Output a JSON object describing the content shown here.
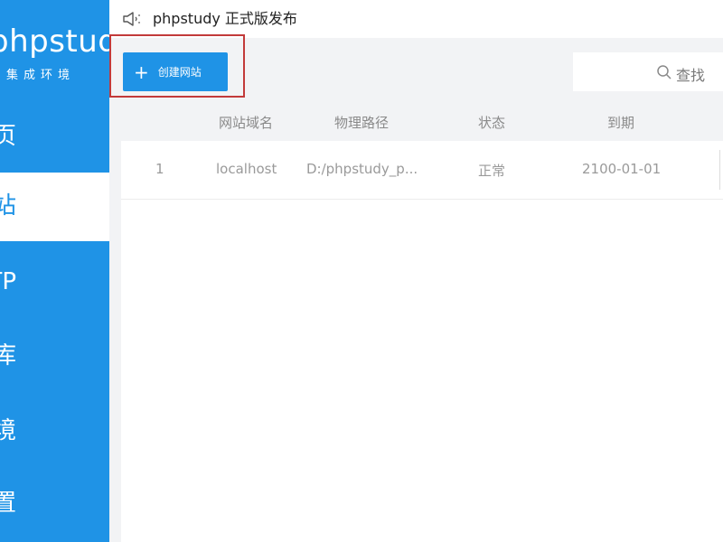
{
  "sidebar": {
    "logo": "phpstudy",
    "logo_sub": "集成环境",
    "items": [
      {
        "label": "首页"
      },
      {
        "label": "网站",
        "active": true
      },
      {
        "label": "FTP"
      },
      {
        "label": "数据库"
      },
      {
        "label": "环境"
      },
      {
        "label": "设置"
      }
    ]
  },
  "topbar": {
    "icon": "speaker-icon",
    "notice": "phpstudy 正式版发布"
  },
  "toolbar": {
    "create_label": "创建网站",
    "create_icon": "plus-icon",
    "search_label": "查找",
    "search_icon": "search-icon"
  },
  "table": {
    "columns": [
      "网站域名",
      "物理路径",
      "状态",
      "到期"
    ],
    "rows": [
      {
        "index": "1",
        "domain": "localhost",
        "path": "D:/phpstudy_p...",
        "status": "正常",
        "expiry": "2100-01-01"
      }
    ]
  },
  "colors": {
    "accent": "#1f93e6",
    "highlight_border": "#c23a3a",
    "background": "#f2f3f5"
  }
}
